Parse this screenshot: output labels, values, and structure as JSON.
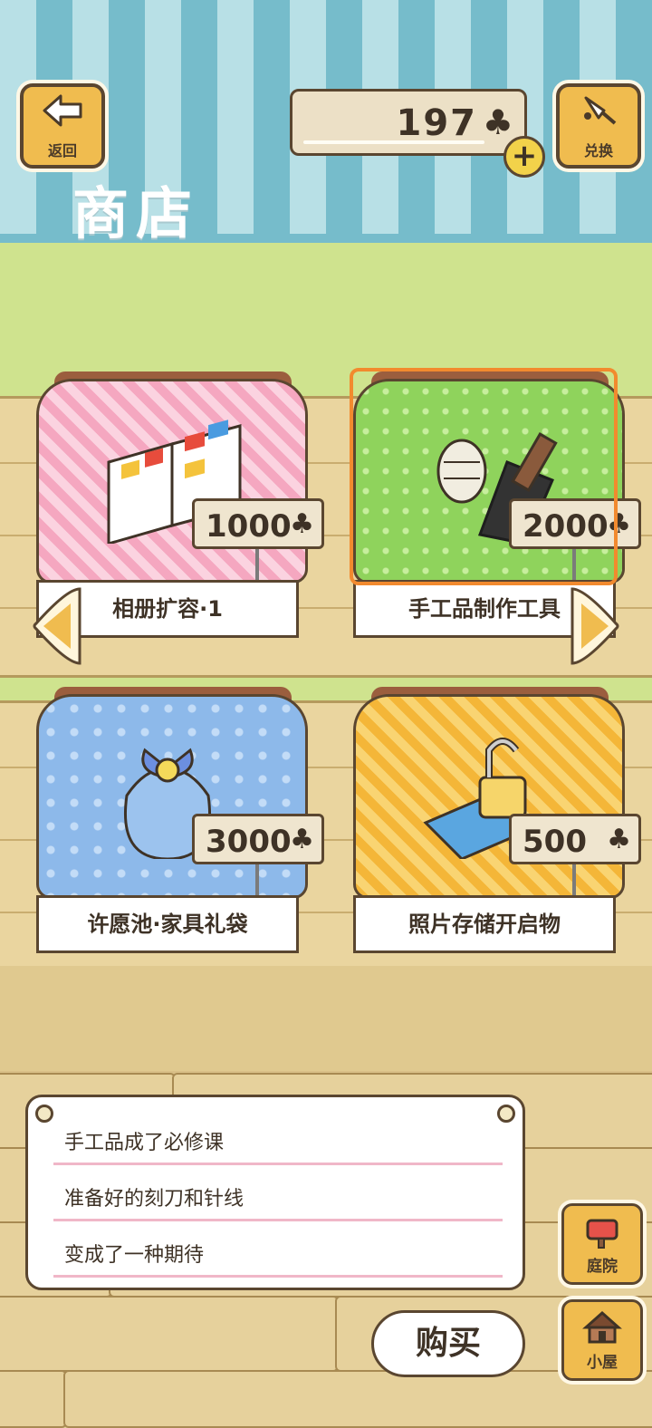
{
  "header": {
    "back_label": "返回",
    "exchange_label": "兑换",
    "title": "商店",
    "currency_amount": "197",
    "currency_icon": "♣",
    "add_icon": "+"
  },
  "items": [
    {
      "name": "相册扩容·1",
      "price": "1000",
      "icon": "album-icon",
      "cloth_color": "#f5a7c0"
    },
    {
      "name": "手工品制作工具",
      "price": "2000",
      "icon": "craft-tools-icon",
      "cloth_color": "#8fd35c",
      "selected": true
    },
    {
      "name": "许愿池·家具礼袋",
      "price": "3000",
      "icon": "gift-bag-icon",
      "cloth_color": "#8db9ea"
    },
    {
      "name": "照片存储开启物",
      "price": "500",
      "icon": "unlock-icon",
      "cloth_color": "#f4b638"
    }
  ],
  "description": {
    "lines": [
      "手工品成了必修课",
      "准备好的刻刀和针线",
      "变成了一种期待"
    ]
  },
  "actions": {
    "buy_label": "购买",
    "yard_label": "庭院",
    "house_label": "小屋"
  },
  "colors": {
    "accent_selected": "#f28a2e",
    "button_bg": "#f0bc4f",
    "outline": "#5a4630"
  }
}
